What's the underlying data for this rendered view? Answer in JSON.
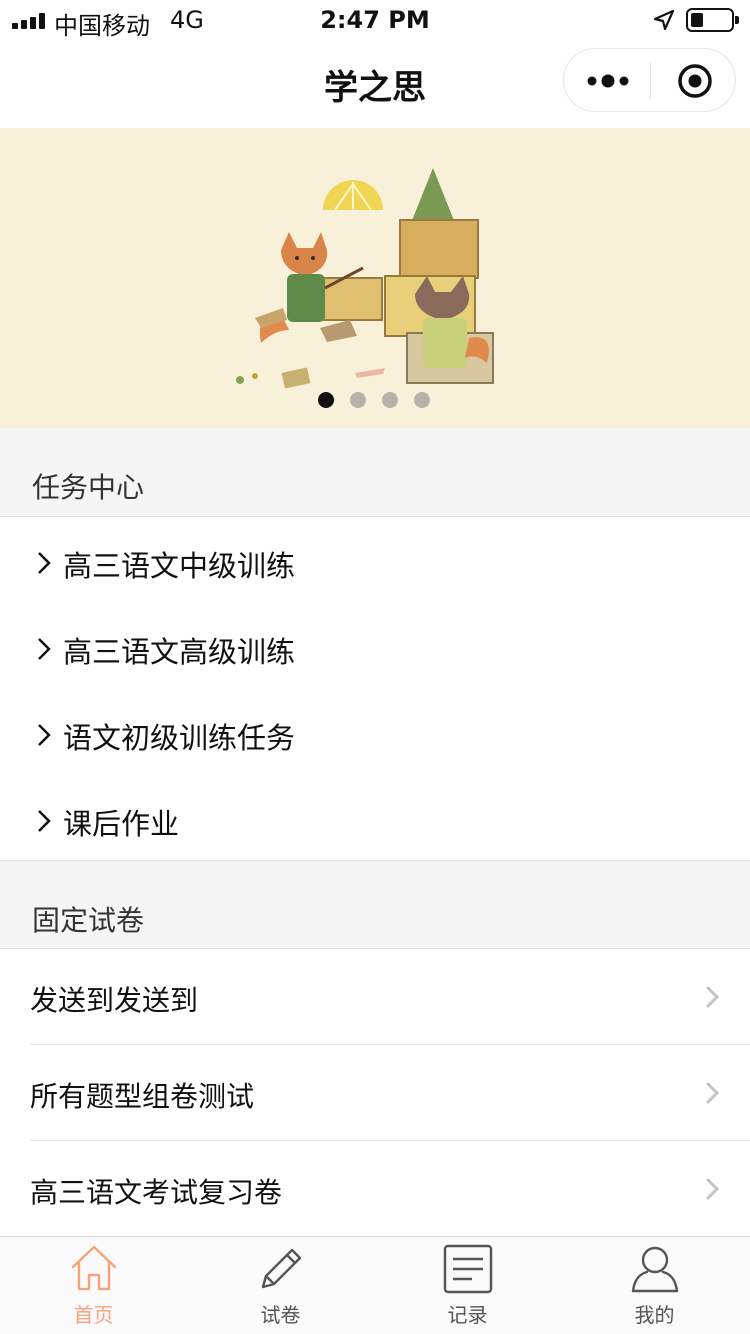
{
  "status_bar": {
    "carrier": "中国移动",
    "network": "4G",
    "time": "2:47 PM"
  },
  "nav": {
    "title": "学之思"
  },
  "banner": {
    "page_count": 4,
    "active_index": 0,
    "dot_active_color": "#111111",
    "dot_inactive_color": "#b4b2aa",
    "background_color": "#f8f0d9"
  },
  "task_center": {
    "title": "任务中心",
    "items": [
      {
        "label": "高三语文中级训练"
      },
      {
        "label": "高三语文高级训练"
      },
      {
        "label": "语文初级训练任务"
      },
      {
        "label": "课后作业"
      }
    ]
  },
  "fixed_papers": {
    "title": "固定试卷",
    "items": [
      {
        "label": "发送到发送到"
      },
      {
        "label": "所有题型组卷测试"
      },
      {
        "label": "高三语文考试复习卷"
      }
    ]
  },
  "tab_bar": {
    "accent_color": "#f5a37a",
    "inactive_color": "#555555",
    "tabs": [
      {
        "label": "首页",
        "icon": "home-icon",
        "active": true
      },
      {
        "label": "试卷",
        "icon": "pencil-icon",
        "active": false
      },
      {
        "label": "记录",
        "icon": "list-icon",
        "active": false
      },
      {
        "label": "我的",
        "icon": "user-icon",
        "active": false
      }
    ]
  }
}
